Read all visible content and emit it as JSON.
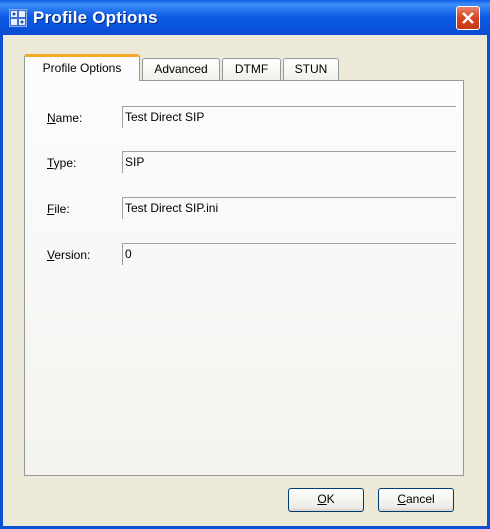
{
  "window": {
    "title": "Profile Options"
  },
  "tabs": [
    {
      "label": "Profile Options",
      "active": true
    },
    {
      "label": "Advanced",
      "active": false
    },
    {
      "label": "DTMF",
      "active": false
    },
    {
      "label": "STUN",
      "active": false
    }
  ],
  "form": {
    "name": {
      "label_first": "N",
      "label_rest": "ame:",
      "value": "Test Direct SIP"
    },
    "type": {
      "label_first": "T",
      "label_rest": "ype:",
      "value": "SIP"
    },
    "file": {
      "label_first": "F",
      "label_rest": "ile:",
      "value": "Test Direct SIP.ini"
    },
    "version": {
      "label_first": "V",
      "label_rest": "ersion:",
      "value": "0"
    }
  },
  "buttons": {
    "ok": {
      "label_first": "O",
      "label_rest": "K"
    },
    "cancel": {
      "label_first": "C",
      "label_rest": "ancel"
    }
  },
  "colors": {
    "titlebar": "#0a55de",
    "tab_highlight": "#f6a828",
    "dialog_bg": "#ece9d8",
    "close_button": "#d6451f"
  },
  "icons": {
    "window": "app-window-icon",
    "close": "close-icon"
  }
}
